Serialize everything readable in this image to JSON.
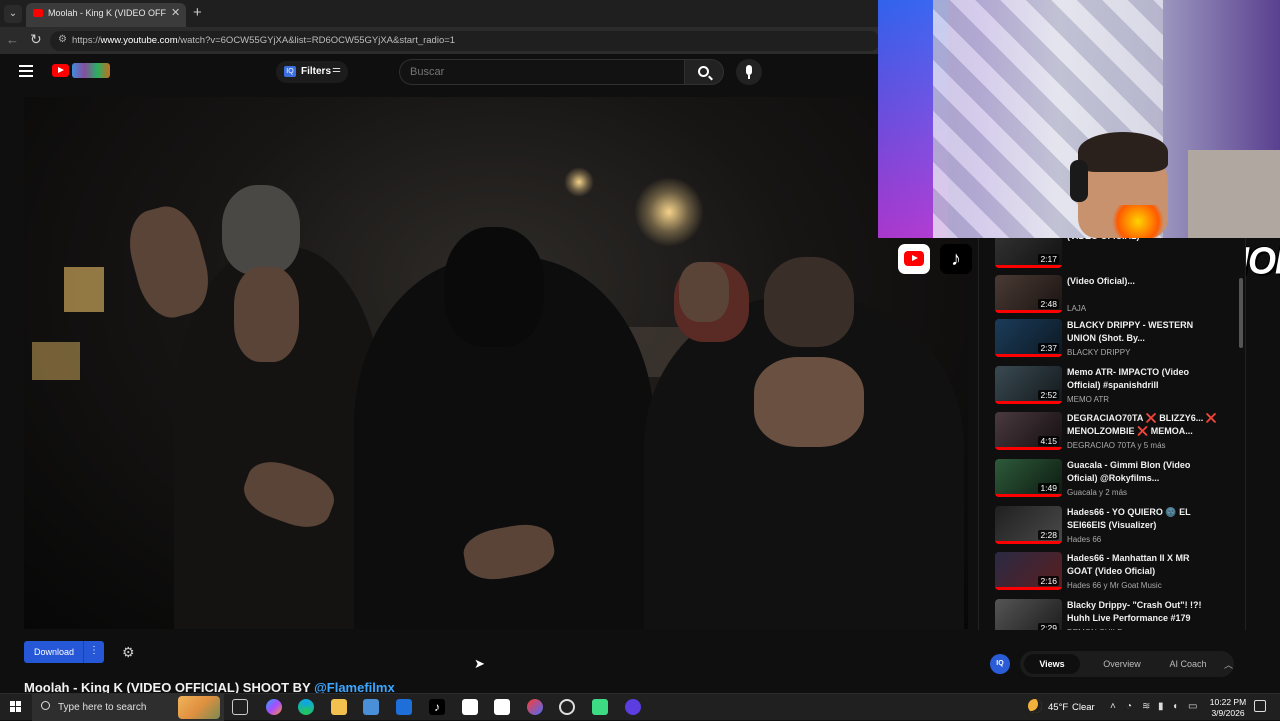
{
  "browser": {
    "tab_title": "Moolah - King K (VIDEO OFFICIAL",
    "url_prefix": "https://",
    "url_host": "www.youtube.com",
    "url_path": "/watch?v=6OCW55GYjXA&list=RD6OCW55GYjXA&start_radio=1"
  },
  "youtube": {
    "filters_label": "Filters",
    "search_placeholder": "Buscar"
  },
  "below_video": {
    "download_label": "Download",
    "download_more": "⋮",
    "title_text": "Moolah - King K (VIDEO OFFICIAL) SHOOT BY ",
    "title_link": "@Flamefilmx"
  },
  "overlay": {
    "channel_name": "YOUNGMINOR"
  },
  "related": [
    {
      "duration": "2:17",
      "title": "(VIDEO OFICIAL)",
      "channel": ""
    },
    {
      "duration": "2:48",
      "title": "(Video Oficial)...",
      "channel": "LAJA"
    },
    {
      "duration": "2:37",
      "title": "BLACKY DRIPPY - WESTERN UNION (Shot. By...",
      "channel": "BLACKY DRIPPY"
    },
    {
      "duration": "2:52",
      "title": "Memo ATR- IMPACTO (Video Official) #spanishdrill",
      "channel": "MEMO ATR"
    },
    {
      "duration": "4:15",
      "title": "DEGRACIAO70TA ❌ BLIZZY6... ❌ MENOLZOMBIE ❌ MEMOA...",
      "channel": "DEGRACIAO 70TA y 5 más"
    },
    {
      "duration": "1:49",
      "title": "Guacala - Gimmi Blon (Video Oficial) @Rokyfilms...",
      "channel": "Guacala y 2 más"
    },
    {
      "duration": "2:28",
      "title": "Hades66 - YO QUIERO 🌚 EL SEI66EIS (Visualizer)",
      "channel": "Hades 66"
    },
    {
      "duration": "2:16",
      "title": "Hades66 - Manhattan II X MR GOAT (Video Oficial)",
      "channel": "Hades 66 y Mr Goat Music"
    },
    {
      "duration": "2:29",
      "title": "Blacky Drippy- \"Crash Out\"! !?! Huhh Live Performance #179",
      "channel": "DEMON CHILD"
    }
  ],
  "views_bar": {
    "logo": "IQ",
    "tabs": [
      "Views",
      "Overview",
      "AI Coach"
    ]
  },
  "taskbar": {
    "search_label": "Type here to search",
    "temperature": "45°F",
    "condition": "Clear",
    "time": "10:22 PM",
    "date": "3/9/2026"
  }
}
